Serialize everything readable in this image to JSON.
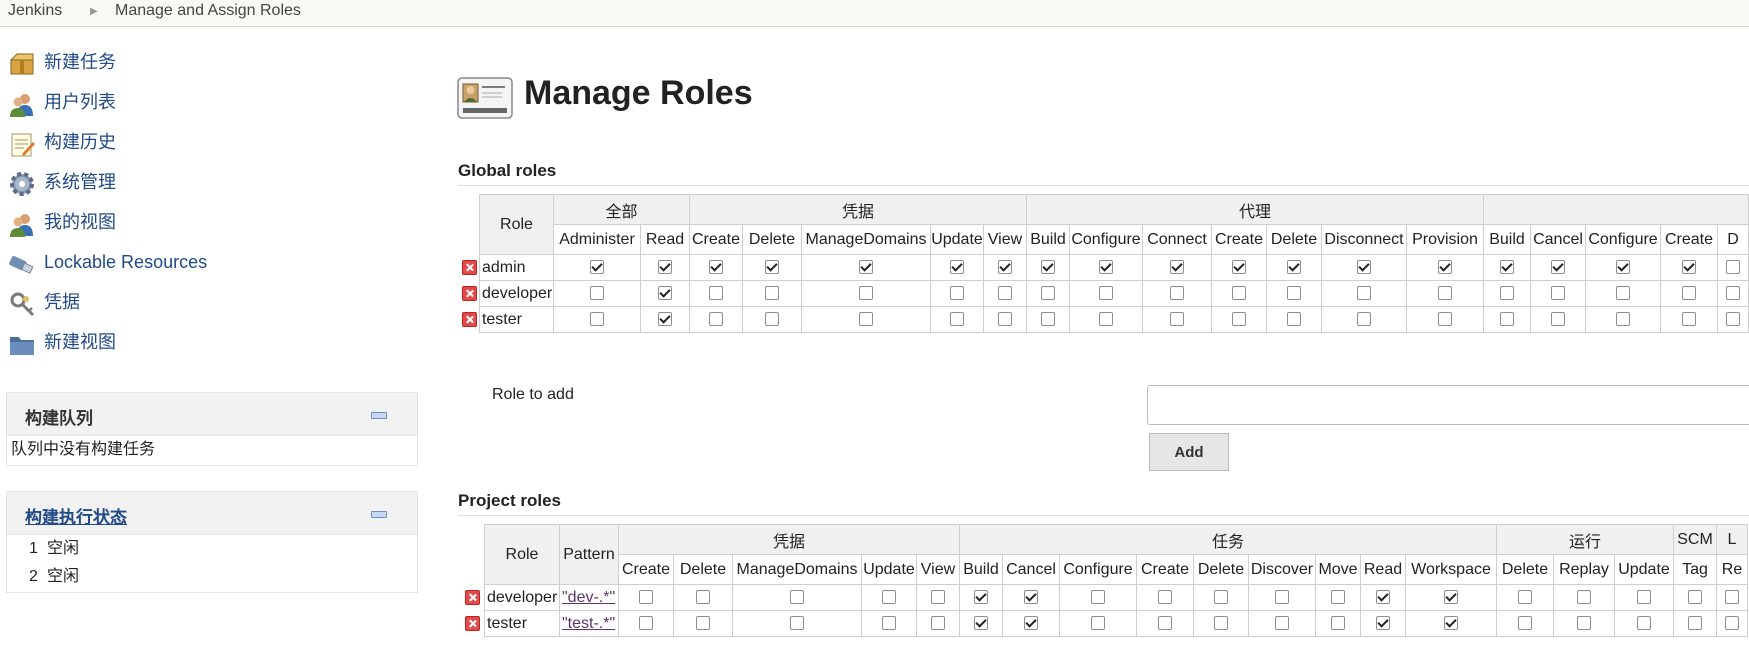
{
  "breadcrumb": {
    "root": "Jenkins",
    "page": "Manage and Assign Roles"
  },
  "sidebar": {
    "tasks": [
      {
        "label": "新建任务",
        "icon": "package-icon"
      },
      {
        "label": "用户列表",
        "icon": "users-icon"
      },
      {
        "label": "构建历史",
        "icon": "notepad-icon"
      },
      {
        "label": "系统管理",
        "icon": "gear-icon"
      },
      {
        "label": "我的视图",
        "icon": "users-icon"
      },
      {
        "label": "Lockable Resources",
        "icon": "usb-icon"
      },
      {
        "label": "凭据",
        "icon": "keys-icon"
      },
      {
        "label": "新建视图",
        "icon": "folder-icon"
      }
    ],
    "build_queue": {
      "title": "构建队列",
      "empty_text": "队列中没有构建任务"
    },
    "executors": {
      "title": "构建执行状态",
      "rows": [
        {
          "num": "1",
          "status": "空闲"
        },
        {
          "num": "2",
          "status": "空闲"
        }
      ]
    }
  },
  "main": {
    "title": "Manage Roles",
    "global_roles": {
      "heading": "Global roles",
      "role_header": "Role",
      "groups": [
        {
          "name": "全部",
          "cols": [
            "Administer",
            "Read"
          ]
        },
        {
          "name": "凭据",
          "cols": [
            "Create",
            "Delete",
            "ManageDomains",
            "Update",
            "View"
          ]
        },
        {
          "name": "代理",
          "cols": [
            "Build",
            "Configure",
            "Connect",
            "Create",
            "Delete",
            "Disconnect",
            "Provision"
          ]
        },
        {
          "name": "",
          "cols": [
            "Build",
            "Cancel",
            "Configure",
            "Create",
            "D"
          ]
        }
      ],
      "rows": [
        {
          "role": "admin",
          "checks": [
            1,
            1,
            1,
            1,
            1,
            1,
            1,
            1,
            1,
            1,
            1,
            1,
            1,
            1,
            1,
            1,
            1,
            1,
            0
          ]
        },
        {
          "role": "developer",
          "checks": [
            0,
            1,
            0,
            0,
            0,
            0,
            0,
            0,
            0,
            0,
            0,
            0,
            0,
            0,
            0,
            0,
            0,
            0,
            0
          ]
        },
        {
          "role": "tester",
          "checks": [
            0,
            1,
            0,
            0,
            0,
            0,
            0,
            0,
            0,
            0,
            0,
            0,
            0,
            0,
            0,
            0,
            0,
            0,
            0
          ]
        }
      ]
    },
    "role_to_add": {
      "label": "Role to add",
      "value": "",
      "button": "Add"
    },
    "project_roles": {
      "heading": "Project roles",
      "role_header": "Role",
      "pattern_header": "Pattern",
      "groups": [
        {
          "name": "凭据",
          "cols": [
            "Create",
            "Delete",
            "ManageDomains",
            "Update",
            "View"
          ]
        },
        {
          "name": "任务",
          "cols": [
            "Build",
            "Cancel",
            "Configure",
            "Create",
            "Delete",
            "Discover",
            "Move",
            "Read",
            "Workspace"
          ]
        },
        {
          "name": "运行",
          "cols": [
            "Delete",
            "Replay",
            "Update"
          ]
        },
        {
          "name": "SCM",
          "cols": [
            "Tag"
          ]
        },
        {
          "name": "L",
          "cols": [
            "Re"
          ]
        }
      ],
      "rows": [
        {
          "role": "developer",
          "pattern": "\"dev-.*\"",
          "checks": [
            0,
            0,
            0,
            0,
            0,
            1,
            1,
            0,
            0,
            0,
            0,
            0,
            1,
            1,
            0,
            0,
            0,
            0,
            0
          ]
        },
        {
          "role": "tester",
          "pattern": "\"test-.*\"",
          "checks": [
            0,
            0,
            0,
            0,
            0,
            1,
            1,
            0,
            0,
            0,
            0,
            0,
            1,
            1,
            0,
            0,
            0,
            0,
            0
          ]
        }
      ]
    }
  }
}
